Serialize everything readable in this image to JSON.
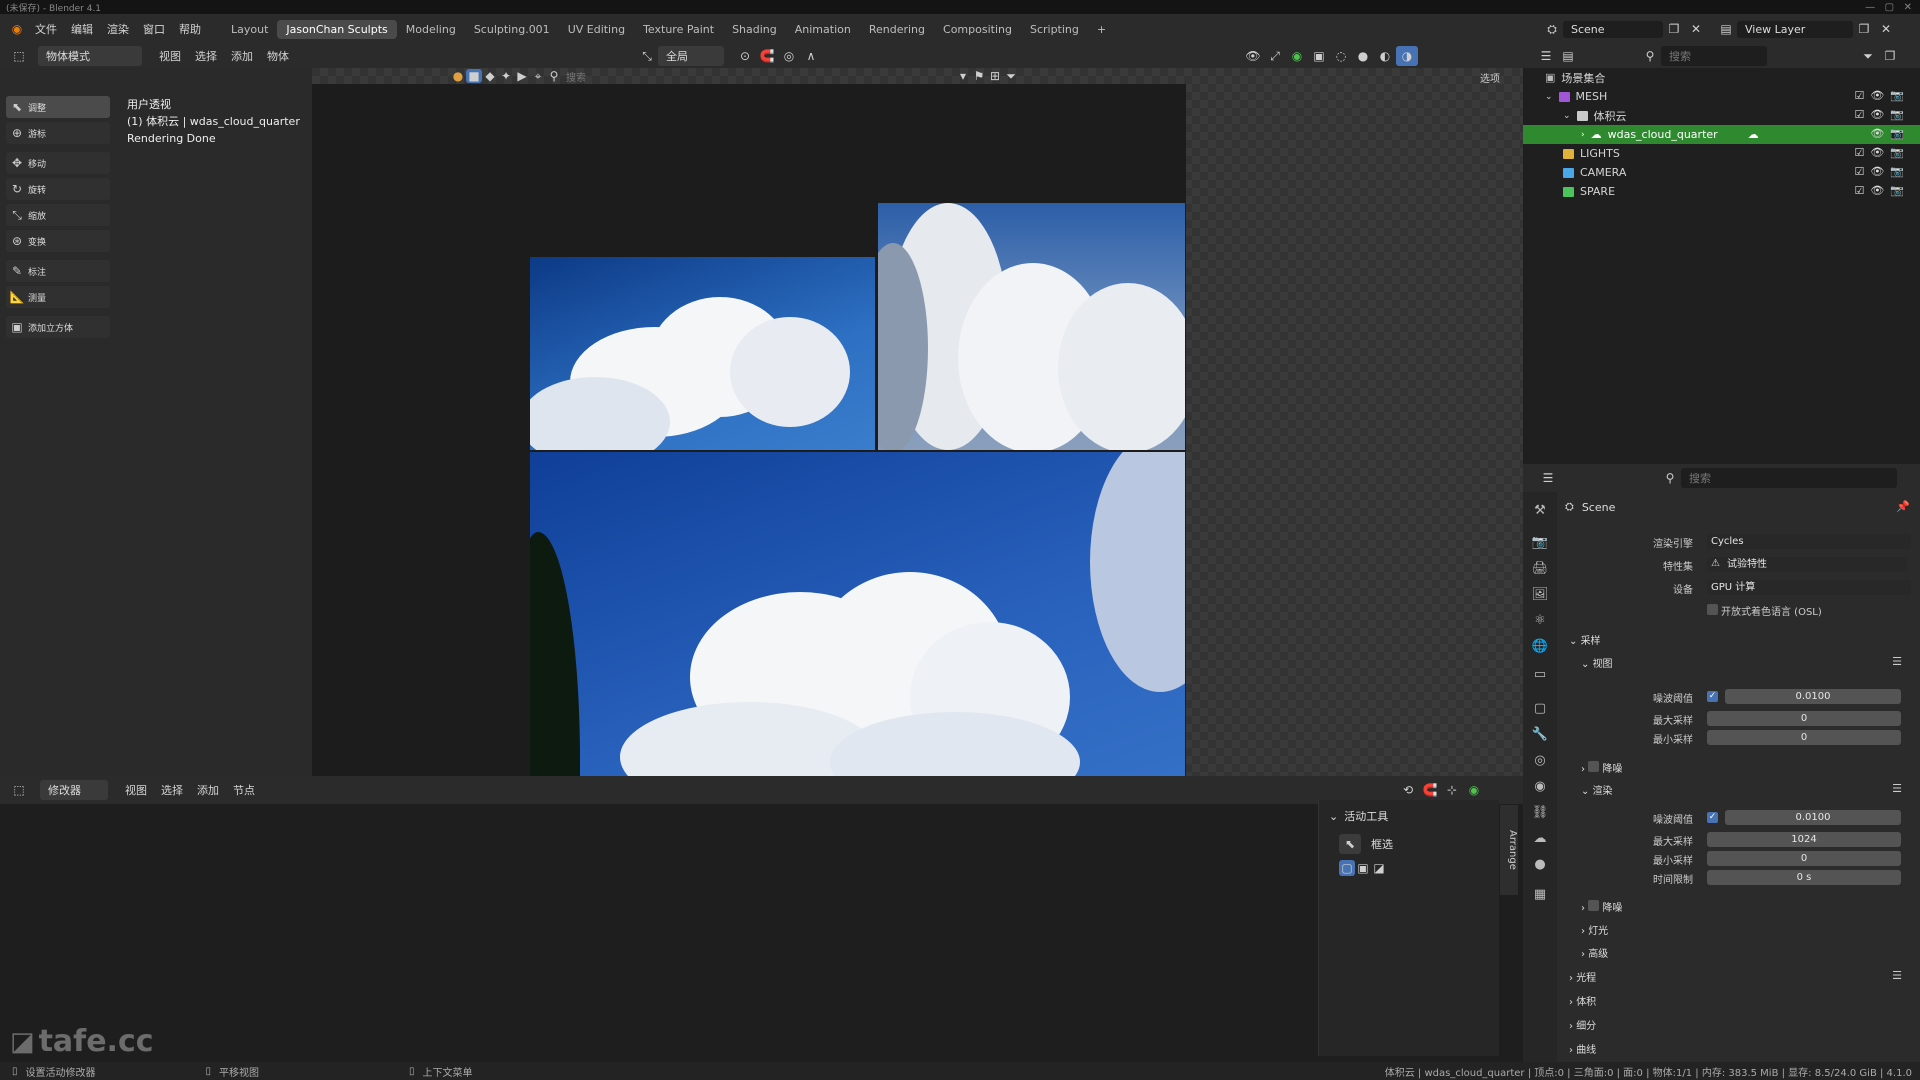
{
  "app": {
    "title": "(未保存) - Blender 4.1"
  },
  "menu": {
    "items": [
      "文件",
      "编辑",
      "渲染",
      "窗口",
      "帮助"
    ]
  },
  "workspaces": [
    "Layout",
    "JasonChan Sculpts",
    "Modeling",
    "Sculpting.001",
    "UV Editing",
    "Texture Paint",
    "Shading",
    "Animation",
    "Rendering",
    "Compositing",
    "Scripting"
  ],
  "active_workspace": "JasonChan Sculpts",
  "scene_selector": {
    "label": "Scene"
  },
  "viewlayer_selector": {
    "label": "View Layer"
  },
  "viewport": {
    "mode": "物体模式",
    "menus": [
      "视图",
      "选择",
      "添加",
      "物体"
    ],
    "transform_orientation": "全局",
    "options_label": "选项",
    "search_placeholder": "搜索",
    "overlay_text": [
      "用户透视",
      "(1) 体积云 | wdas_cloud_quarter",
      "Rendering Done"
    ],
    "tools": [
      {
        "label": "调整",
        "icon": "select-icon",
        "active": true
      },
      {
        "label": "游标",
        "icon": "cursor-icon"
      },
      {
        "label": "移动",
        "icon": "move-icon"
      },
      {
        "label": "旋转",
        "icon": "rotate-icon"
      },
      {
        "label": "缩放",
        "icon": "scale-icon"
      },
      {
        "label": "变换",
        "icon": "transform-icon"
      },
      {
        "label": "标注",
        "icon": "annotate-icon"
      },
      {
        "label": "测量",
        "icon": "measure-icon"
      },
      {
        "label": "添加立方体",
        "icon": "add-cube-icon"
      }
    ]
  },
  "node_editor": {
    "type_label": "修改器",
    "menus": [
      "视图",
      "选择",
      "添加",
      "节点"
    ],
    "active_tool_title": "活动工具",
    "active_tool_name": "框选",
    "side_tab": "Arrange"
  },
  "outliner": {
    "search_placeholder": "搜索",
    "rows": [
      {
        "label": "场景集合",
        "indent": 0,
        "type": "scene"
      },
      {
        "label": "MESH",
        "indent": 1,
        "type": "collection"
      },
      {
        "label": "体积云",
        "indent": 2,
        "type": "collection"
      },
      {
        "label": "wdas_cloud_quarter",
        "indent": 3,
        "type": "object",
        "selected": true
      },
      {
        "label": "LIGHTS",
        "indent": 1,
        "type": "collection"
      },
      {
        "label": "CAMERA",
        "indent": 1,
        "type": "collection"
      },
      {
        "label": "SPARE",
        "indent": 1,
        "type": "collection"
      }
    ]
  },
  "properties": {
    "search_placeholder": "搜索",
    "context": "Scene",
    "render_engine_label": "渲染引擎",
    "render_engine": "Cycles",
    "feature_set_label": "特性集",
    "feature_set": "试验特性",
    "device_label": "设备",
    "device": "GPU 计算",
    "osl_label": "开放式着色语言 (OSL)",
    "sampling_label": "采样",
    "viewport_label": "视图",
    "noise_threshold_label": "噪波阈值",
    "viewport_noise_threshold": "0.0100",
    "max_samples_label": "最大采样",
    "viewport_max_samples": "0",
    "min_samples_label": "最小采样",
    "viewport_min_samples": "0",
    "denoise_label": "降噪",
    "render_label": "渲染",
    "render_noise_threshold": "0.0100",
    "render_max_samples": "1024",
    "render_min_samples": "0",
    "time_limit_label": "时间限制",
    "time_limit": "0 s",
    "lights_label": "灯光",
    "advanced_label": "高级",
    "light_paths_label": "光程",
    "volumes_label": "体积",
    "subdivision_label": "细分",
    "curves_label": "曲线"
  },
  "statusbar": {
    "left": "设置活动修改器",
    "middle1": "平移视图",
    "middle2": "上下文菜单",
    "right": "体积云 | wdas_cloud_quarter | 顶点:0 | 三角面:0 | 面:0 | 物体:1/1 | 内存: 383.5 MiB | 显存: 8.5/24.0 GiB | 4.1.0"
  },
  "watermark": "tafe.cc"
}
